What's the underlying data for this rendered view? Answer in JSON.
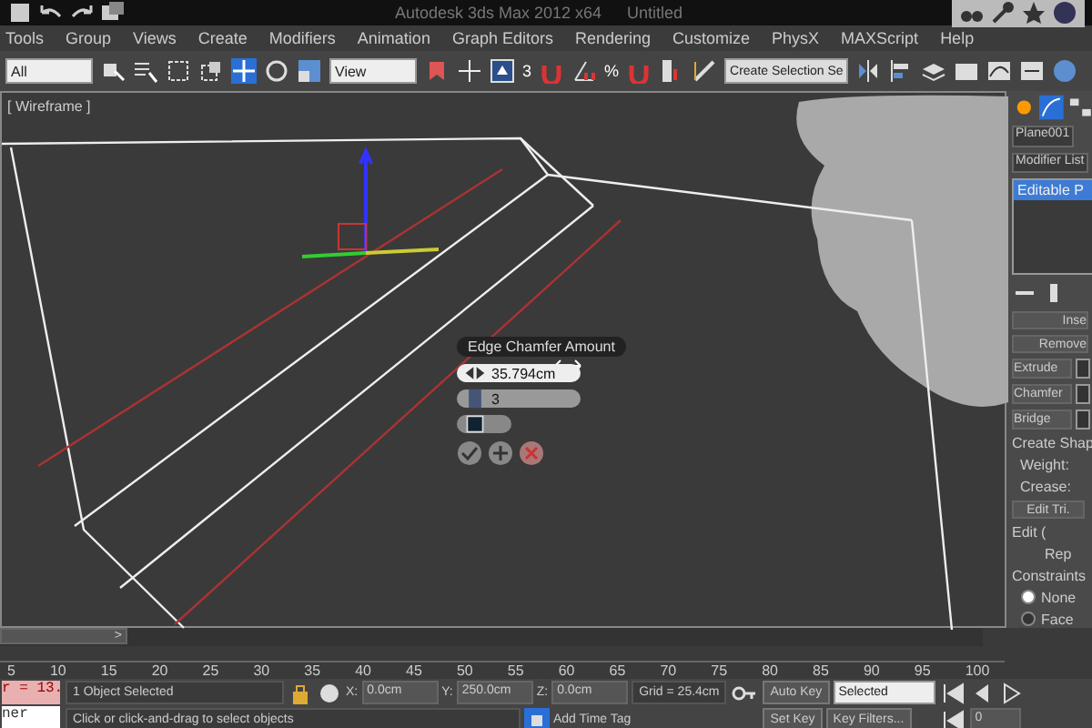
{
  "title_bar": {
    "app": "Autodesk 3ds Max 2012 x64",
    "document": "Untitled"
  },
  "menu": [
    "Tools",
    "Group",
    "Views",
    "Create",
    "Modifiers",
    "Animation",
    "Graph Editors",
    "Rendering",
    "Customize",
    "PhysX",
    "MAXScript",
    "Help"
  ],
  "toolbar": {
    "selection_filter": "All",
    "coordinate_system": "View",
    "snap_labels": [
      "3",
      "%"
    ],
    "named_selection": "Create Selection Se"
  },
  "viewport": {
    "label": "[ Wireframe ]"
  },
  "caddy": {
    "title": "Edge Chamfer Amount",
    "amount": "35.794cm",
    "segments": "3"
  },
  "command_panel": {
    "object_name": "Plane001",
    "modifier_list": "Modifier List",
    "stack_items": [
      {
        "label": "Editable P",
        "selected": true
      }
    ],
    "buttons": [
      "Inse",
      "Remove"
    ],
    "settings_buttons": [
      "Extrude",
      "Chamfer",
      "Bridge"
    ],
    "create_shape": "Create Shap",
    "weight_label": "Weight:",
    "crease_label": "Crease:",
    "edit_tri": "Edit Tri.",
    "edit_rollout": "Edit (",
    "rep": "Rep",
    "constraints": "Constraints",
    "radios": [
      {
        "label": "None",
        "selected": true
      },
      {
        "label": "Face",
        "selected": false
      }
    ]
  },
  "timeline": {
    "slider_label": ">",
    "ticks": [
      "5",
      "10",
      "15",
      "20",
      "25",
      "30",
      "35",
      "40",
      "45",
      "50",
      "55",
      "60",
      "65",
      "70",
      "75",
      "80",
      "85",
      "90",
      "95",
      "100"
    ]
  },
  "status": {
    "script_lines": [
      "r = 13.",
      "ner"
    ],
    "selection": "1 Object Selected",
    "prompt": "Click or click-and-drag to select objects",
    "x_label": "X:",
    "x": "0.0cm",
    "y_label": "Y:",
    "y": "250.0cm",
    "z_label": "Z:",
    "z": "0.0cm",
    "grid": "Grid = 25.4cm",
    "add_time_tag": "Add Time Tag",
    "auto_key": "Auto Key",
    "set_key": "Set Key",
    "key_mode": "Selected",
    "key_filters": "Key Filters...",
    "frame": "0"
  }
}
